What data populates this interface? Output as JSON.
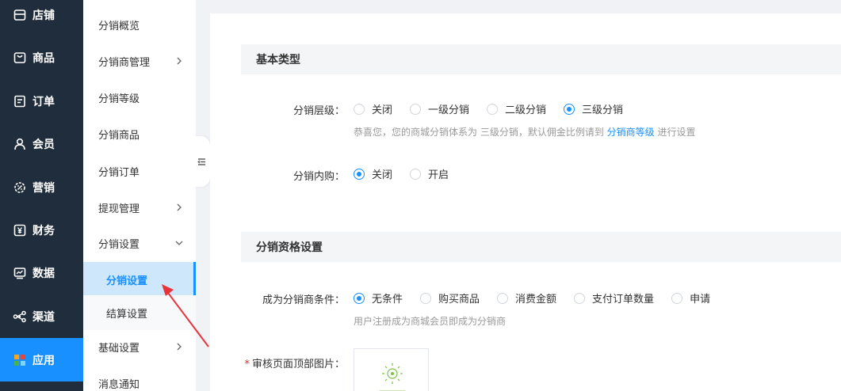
{
  "primary_nav": {
    "items": [
      {
        "label": "店铺",
        "icon": "store-icon"
      },
      {
        "label": "商品",
        "icon": "bag-icon"
      },
      {
        "label": "订单",
        "icon": "order-icon"
      },
      {
        "label": "会员",
        "icon": "user-icon"
      },
      {
        "label": "营销",
        "icon": "marketing-icon"
      },
      {
        "label": "财务",
        "icon": "yuan-icon"
      },
      {
        "label": "数据",
        "icon": "chart-icon"
      },
      {
        "label": "渠道",
        "icon": "share-icon"
      },
      {
        "label": "应用",
        "icon": "apps-icon"
      }
    ],
    "active_color": "#1890ff"
  },
  "secondary_nav": {
    "items": [
      {
        "label": "分销概览"
      },
      {
        "label": "分销商管理"
      },
      {
        "label": "分销等级"
      },
      {
        "label": "分销商品"
      },
      {
        "label": "分销订单"
      },
      {
        "label": "提现管理"
      },
      {
        "label": "分销设置"
      },
      {
        "label": "分销设置"
      },
      {
        "label": "结算设置"
      },
      {
        "label": "基础设置"
      },
      {
        "label": "消息通知"
      }
    ]
  },
  "basic_type": {
    "title": "基本类型",
    "level": {
      "label": "分销层级：",
      "options": [
        "关闭",
        "一级分销",
        "二级分销",
        "三级分销"
      ],
      "selected": "三级分销",
      "hint_prefix": "恭喜您，您的商城分销体系为 三级分销，默认佣金比例请到",
      "hint_link": "分销商等级",
      "hint_suffix": "进行设置"
    },
    "internal_purchase": {
      "label": "分销内购：",
      "options": [
        "关闭",
        "开启"
      ],
      "selected": "关闭"
    }
  },
  "qualification": {
    "title": "分销资格设置",
    "condition": {
      "label": "成为分销商条件：",
      "options": [
        "无条件",
        "购买商品",
        "消费金额",
        "支付订单数量",
        "申请"
      ],
      "selected": "无条件",
      "hint": "用户注册成为商城会员即成为分销商"
    },
    "header_image": {
      "required_mark": "*",
      "label": "审核页面顶部图片："
    }
  }
}
